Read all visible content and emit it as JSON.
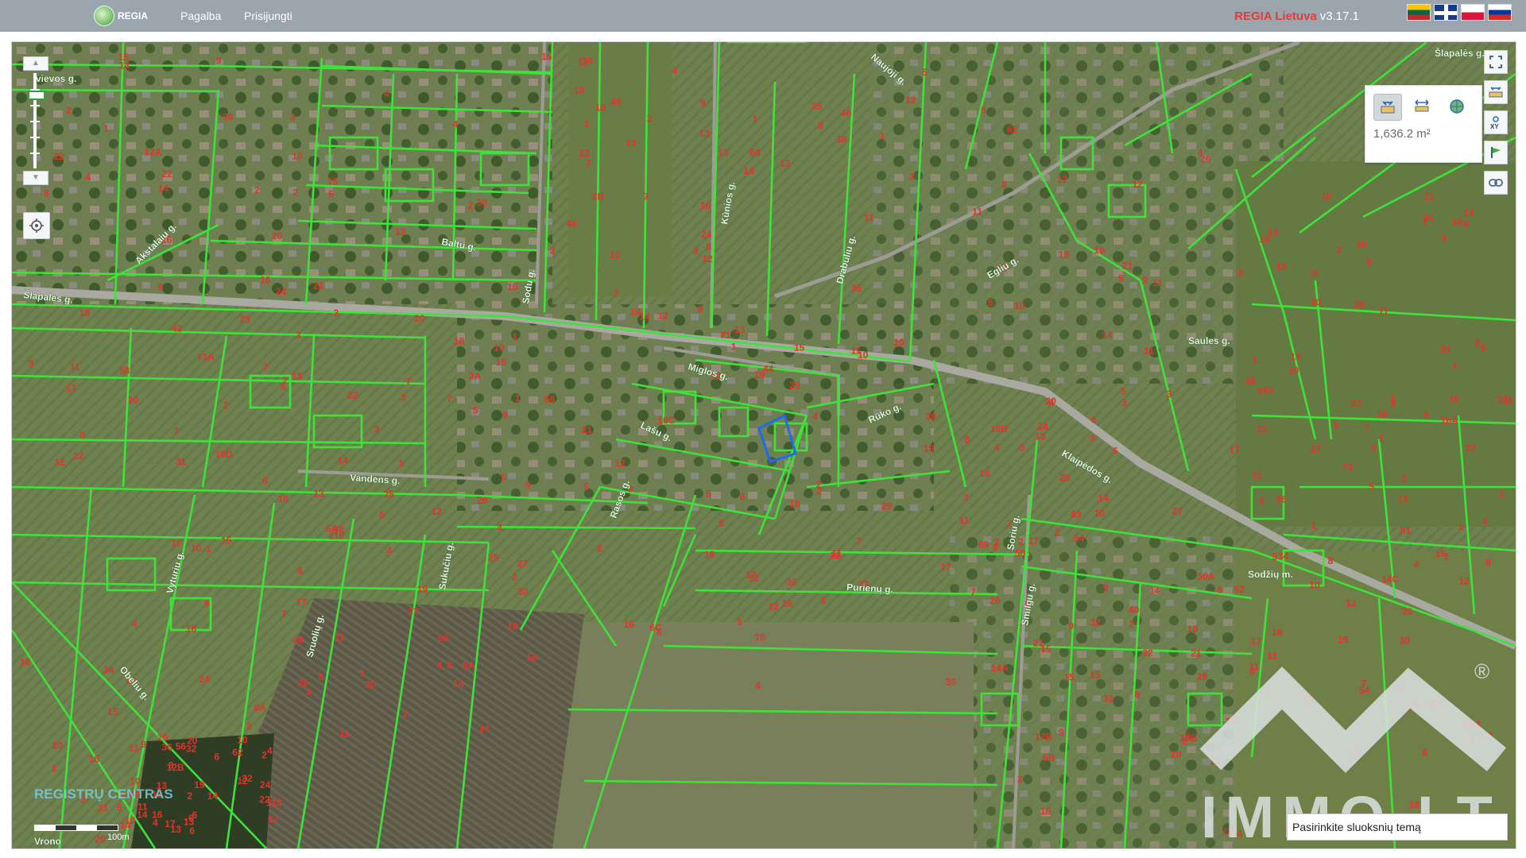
{
  "header": {
    "logo_text": "REGIA",
    "nav": [
      "Pagalba",
      "Prisijungti"
    ],
    "brand": "REGIA Lietuva",
    "version": "v3.17.1",
    "languages": [
      "lt",
      "en",
      "pl",
      "ru"
    ]
  },
  "measure": {
    "area_value": "1,636.2 m²"
  },
  "layer_selector": {
    "label": "Pasirinkite sluoksnių temą"
  },
  "watermark": {
    "text": "IMMO.LT",
    "registered": "®",
    "provider": "REGISTRŲ CENTRAS"
  },
  "scale": {
    "label": "100m"
  },
  "streets": [
    {
      "id": "slapaliu-w",
      "text": "Šlapalės g."
    },
    {
      "id": "slapaliu-ne",
      "text": "Šlapalės g."
    },
    {
      "id": "vievios",
      "text": "vievos g."
    },
    {
      "id": "akstalaiu",
      "text": "Akstalaiu g."
    },
    {
      "id": "baltu",
      "text": "Baltu g."
    },
    {
      "id": "sodu",
      "text": "Sodu g."
    },
    {
      "id": "kaunos",
      "text": "Kūnios g."
    },
    {
      "id": "drabuliu",
      "text": "Drabuliu g."
    },
    {
      "id": "egliu",
      "text": "Egliu g."
    },
    {
      "id": "naujoji",
      "text": "Naujoji g."
    },
    {
      "id": "saules",
      "text": "Saules g."
    },
    {
      "id": "miglos",
      "text": "Miglos g."
    },
    {
      "id": "ruko",
      "text": "Rūko g."
    },
    {
      "id": "lasu",
      "text": "Lašu g."
    },
    {
      "id": "rasos",
      "text": "Rasos g."
    },
    {
      "id": "klaipedos",
      "text": "Klaipėdos g."
    },
    {
      "id": "vandens",
      "text": "Vandens g."
    },
    {
      "id": "vyturiu",
      "text": "Vyturiu g."
    },
    {
      "id": "sukuciu",
      "text": "Sukučiu g."
    },
    {
      "id": "sruoliu",
      "text": "Sruolių g."
    },
    {
      "id": "obeliu",
      "text": "Obeliu g."
    },
    {
      "id": "purienu",
      "text": "Purienų g."
    },
    {
      "id": "smilgu",
      "text": "Smilgu g."
    },
    {
      "id": "soriu",
      "text": "Soriu g."
    },
    {
      "id": "sodzius",
      "text": "Sodžių m."
    },
    {
      "id": "vrono",
      "text": "Vrono"
    }
  ],
  "parcels": [
    {
      "t": "2"
    },
    {
      "t": "1"
    },
    {
      "t": "11"
    },
    {
      "t": "9"
    },
    {
      "t": "7"
    },
    {
      "t": "5"
    },
    {
      "t": "3"
    },
    {
      "t": "1"
    },
    {
      "t": "10"
    },
    {
      "t": "17"
    },
    {
      "t": "8"
    },
    {
      "t": "15"
    },
    {
      "t": "6"
    },
    {
      "t": "4"
    },
    {
      "t": "2"
    },
    {
      "t": "13"
    },
    {
      "t": "11"
    },
    {
      "t": "10"
    },
    {
      "t": "7"
    },
    {
      "t": "9"
    },
    {
      "t": "6"
    },
    {
      "t": "5"
    },
    {
      "t": "3"
    },
    {
      "t": "4"
    },
    {
      "t": "1"
    },
    {
      "t": "2"
    },
    {
      "t": "18"
    },
    {
      "t": "20"
    },
    {
      "t": "22"
    },
    {
      "t": "24"
    },
    {
      "t": "26"
    },
    {
      "t": "28"
    },
    {
      "t": "16D"
    },
    {
      "t": "16C"
    },
    {
      "t": "16B"
    },
    {
      "t": "16A"
    },
    {
      "t": "16"
    },
    {
      "t": "14"
    },
    {
      "t": "14A"
    },
    {
      "t": "14B"
    },
    {
      "t": "14C"
    },
    {
      "t": "12B"
    },
    {
      "t": "12A"
    },
    {
      "t": "12"
    },
    {
      "t": "10"
    },
    {
      "t": "8"
    },
    {
      "t": "6"
    },
    {
      "t": "4"
    },
    {
      "t": "2"
    },
    {
      "t": "3"
    },
    {
      "t": "1"
    },
    {
      "t": "25"
    },
    {
      "t": "27"
    },
    {
      "t": "20"
    },
    {
      "t": "18"
    },
    {
      "t": "16"
    },
    {
      "t": "14"
    },
    {
      "t": "12"
    },
    {
      "t": "10"
    },
    {
      "t": "8"
    },
    {
      "t": "23"
    },
    {
      "t": "21"
    },
    {
      "t": "19"
    },
    {
      "t": "17"
    },
    {
      "t": "15"
    },
    {
      "t": "13"
    },
    {
      "t": "11"
    },
    {
      "t": "9"
    },
    {
      "t": "7"
    },
    {
      "t": "5"
    },
    {
      "t": "20"
    },
    {
      "t": "18"
    },
    {
      "t": "16"
    },
    {
      "t": "14"
    },
    {
      "t": "12"
    },
    {
      "t": "10"
    },
    {
      "t": "8"
    },
    {
      "t": "6"
    },
    {
      "t": "4"
    },
    {
      "t": "2"
    },
    {
      "t": "16"
    },
    {
      "t": "18"
    },
    {
      "t": "20"
    },
    {
      "t": "22"
    },
    {
      "t": "24"
    },
    {
      "t": "14"
    },
    {
      "t": "12"
    },
    {
      "t": "10"
    },
    {
      "t": "8"
    },
    {
      "t": "6"
    },
    {
      "t": "4"
    },
    {
      "t": "2"
    },
    {
      "t": "16"
    },
    {
      "t": "14"
    },
    {
      "t": "12"
    },
    {
      "t": "10"
    },
    {
      "t": "8"
    },
    {
      "t": "6"
    },
    {
      "t": "4"
    },
    {
      "t": "9"
    },
    {
      "t": "11"
    },
    {
      "t": "10"
    },
    {
      "t": "7"
    },
    {
      "t": "5"
    },
    {
      "t": "3"
    },
    {
      "t": "1"
    },
    {
      "t": "21"
    },
    {
      "t": "19"
    },
    {
      "t": "17"
    },
    {
      "t": "15"
    },
    {
      "t": "13"
    },
    {
      "t": "11"
    },
    {
      "t": "3"
    },
    {
      "t": "7"
    },
    {
      "t": "5"
    },
    {
      "t": "1"
    },
    {
      "t": "2"
    },
    {
      "t": "10"
    },
    {
      "t": "24"
    },
    {
      "t": "22"
    },
    {
      "t": "20"
    },
    {
      "t": "26"
    },
    {
      "t": "30"
    },
    {
      "t": "32"
    },
    {
      "t": "34"
    },
    {
      "t": "18"
    },
    {
      "t": "16"
    },
    {
      "t": "14"
    },
    {
      "t": "12"
    },
    {
      "t": "10"
    },
    {
      "t": "8"
    },
    {
      "t": "6"
    },
    {
      "t": "4"
    },
    {
      "t": "2"
    },
    {
      "t": "8A"
    },
    {
      "t": "6A"
    },
    {
      "t": "6C"
    },
    {
      "t": "6B"
    },
    {
      "t": "1"
    },
    {
      "t": "3"
    },
    {
      "t": "5"
    },
    {
      "t": "7"
    },
    {
      "t": "9"
    },
    {
      "t": "11"
    },
    {
      "t": "13"
    },
    {
      "t": "15"
    },
    {
      "t": "17"
    },
    {
      "t": "1"
    },
    {
      "t": "3"
    },
    {
      "t": "5"
    },
    {
      "t": "7"
    },
    {
      "t": "9"
    },
    {
      "t": "11"
    },
    {
      "t": "13"
    },
    {
      "t": "2"
    },
    {
      "t": "4"
    },
    {
      "t": "6"
    },
    {
      "t": "8"
    },
    {
      "t": "10"
    },
    {
      "t": "12"
    },
    {
      "t": "14"
    },
    {
      "t": "16"
    },
    {
      "t": "18"
    },
    {
      "t": "25"
    },
    {
      "t": "23"
    },
    {
      "t": "21"
    },
    {
      "t": "19"
    },
    {
      "t": "17"
    },
    {
      "t": "15"
    },
    {
      "t": "13"
    },
    {
      "t": "11"
    },
    {
      "t": "5"
    },
    {
      "t": "3"
    },
    {
      "t": "1"
    },
    {
      "t": "6"
    },
    {
      "t": "8"
    },
    {
      "t": "10"
    },
    {
      "t": "4"
    },
    {
      "t": "2"
    },
    {
      "t": "15"
    },
    {
      "t": "17"
    },
    {
      "t": "19"
    },
    {
      "t": "21"
    },
    {
      "t": "23"
    },
    {
      "t": "25"
    },
    {
      "t": "13"
    },
    {
      "t": "11"
    },
    {
      "t": "9"
    },
    {
      "t": "7"
    },
    {
      "t": "5"
    },
    {
      "t": "3"
    },
    {
      "t": "1"
    },
    {
      "t": "12"
    },
    {
      "t": "10"
    },
    {
      "t": "8"
    },
    {
      "t": "6"
    },
    {
      "t": "4"
    },
    {
      "t": "2"
    },
    {
      "t": "21"
    },
    {
      "t": "19"
    },
    {
      "t": "17"
    },
    {
      "t": "15"
    },
    {
      "t": "13"
    },
    {
      "t": "11"
    },
    {
      "t": "9"
    },
    {
      "t": "7"
    },
    {
      "t": "5"
    },
    {
      "t": "3"
    },
    {
      "t": "1"
    },
    {
      "t": "10"
    },
    {
      "t": "2"
    },
    {
      "t": "1"
    },
    {
      "t": "3"
    },
    {
      "t": "5"
    },
    {
      "t": "7"
    },
    {
      "t": "9"
    },
    {
      "t": "11"
    },
    {
      "t": "13"
    },
    {
      "t": "15"
    },
    {
      "t": "17"
    },
    {
      "t": "19"
    },
    {
      "t": "2"
    },
    {
      "t": "4"
    },
    {
      "t": "6"
    },
    {
      "t": "8"
    },
    {
      "t": "10"
    },
    {
      "t": "12"
    },
    {
      "t": "14"
    },
    {
      "t": "16"
    },
    {
      "t": "18"
    },
    {
      "t": "5"
    },
    {
      "t": "22"
    },
    {
      "t": "20"
    },
    {
      "t": "18"
    },
    {
      "t": "16"
    },
    {
      "t": "14"
    },
    {
      "t": "12"
    },
    {
      "t": "10"
    },
    {
      "t": "8"
    },
    {
      "t": "6"
    },
    {
      "t": "4"
    },
    {
      "t": "2"
    },
    {
      "t": "3"
    },
    {
      "t": "1"
    },
    {
      "t": "83"
    },
    {
      "t": "81"
    },
    {
      "t": "113"
    },
    {
      "t": "110"
    },
    {
      "t": "23"
    },
    {
      "t": "21"
    },
    {
      "t": "19"
    },
    {
      "t": "17"
    },
    {
      "t": "15"
    },
    {
      "t": "13"
    },
    {
      "t": "11"
    },
    {
      "t": "9"
    },
    {
      "t": "7"
    },
    {
      "t": "5"
    },
    {
      "t": "3"
    },
    {
      "t": "1"
    },
    {
      "t": "62"
    },
    {
      "t": "60"
    },
    {
      "t": "58"
    },
    {
      "t": "52"
    },
    {
      "t": "54"
    },
    {
      "t": "56"
    },
    {
      "t": "50"
    },
    {
      "t": "48"
    },
    {
      "t": "46"
    },
    {
      "t": "40"
    },
    {
      "t": "42"
    },
    {
      "t": "44"
    },
    {
      "t": "38"
    },
    {
      "t": "36"
    },
    {
      "t": "34"
    },
    {
      "t": "28"
    },
    {
      "t": "30"
    },
    {
      "t": "32"
    },
    {
      "t": "26"
    },
    {
      "t": "24"
    },
    {
      "t": "22"
    },
    {
      "t": "16"
    },
    {
      "t": "18"
    },
    {
      "t": "20"
    },
    {
      "t": "14"
    },
    {
      "t": "12"
    },
    {
      "t": "10"
    },
    {
      "t": "4"
    },
    {
      "t": "6"
    },
    {
      "t": "8"
    },
    {
      "t": "2"
    },
    {
      "t": "17B"
    },
    {
      "t": "17A"
    },
    {
      "t": "19"
    },
    {
      "t": "4"
    },
    {
      "t": "6"
    },
    {
      "t": "8"
    },
    {
      "t": "10"
    },
    {
      "t": "12"
    },
    {
      "t": "2"
    },
    {
      "t": "20"
    },
    {
      "t": "5"
    },
    {
      "t": "1"
    },
    {
      "t": "3"
    },
    {
      "t": "7"
    },
    {
      "t": "9"
    },
    {
      "t": "11"
    },
    {
      "t": "13"
    },
    {
      "t": "15"
    },
    {
      "t": "10"
    },
    {
      "t": "12"
    },
    {
      "t": "14"
    },
    {
      "t": "71A"
    },
    {
      "t": "71"
    },
    {
      "t": "69"
    },
    {
      "t": "73"
    },
    {
      "t": "2"
    },
    {
      "t": "5A"
    },
    {
      "t": "50"
    },
    {
      "t": "50A"
    },
    {
      "t": "12"
    },
    {
      "t": "14"
    },
    {
      "t": "16"
    },
    {
      "t": "10"
    },
    {
      "t": "6"
    },
    {
      "t": "1"
    },
    {
      "t": "3"
    },
    {
      "t": "5"
    },
    {
      "t": "2"
    },
    {
      "t": "4"
    },
    {
      "t": "6"
    },
    {
      "t": "8"
    },
    {
      "t": "30"
    },
    {
      "t": "32"
    },
    {
      "t": "34"
    },
    {
      "t": "36"
    },
    {
      "t": "1"
    },
    {
      "t": "3"
    },
    {
      "t": "5"
    },
    {
      "t": "7"
    },
    {
      "t": "2"
    },
    {
      "t": "4"
    },
    {
      "t": "6"
    },
    {
      "t": "22"
    },
    {
      "t": "24"
    },
    {
      "t": "20"
    },
    {
      "t": "26"
    },
    {
      "t": "28"
    },
    {
      "t": "30"
    },
    {
      "t": "32"
    },
    {
      "t": "10"
    },
    {
      "t": "12"
    },
    {
      "t": "14"
    },
    {
      "t": "16"
    },
    {
      "t": "18"
    },
    {
      "t": "1"
    },
    {
      "t": "3"
    },
    {
      "t": "5"
    },
    {
      "t": "2"
    },
    {
      "t": "4"
    },
    {
      "t": "6"
    },
    {
      "t": "8"
    },
    {
      "t": "10"
    },
    {
      "t": "12"
    },
    {
      "t": "14"
    },
    {
      "t": "16"
    },
    {
      "t": "1"
    },
    {
      "t": "2"
    },
    {
      "t": "3"
    },
    {
      "t": "3A"
    },
    {
      "t": "5"
    },
    {
      "t": "7"
    },
    {
      "t": "9"
    },
    {
      "t": "11"
    },
    {
      "t": "4"
    },
    {
      "t": "6"
    },
    {
      "t": "8"
    },
    {
      "t": "10"
    },
    {
      "t": "12"
    },
    {
      "t": "64"
    },
    {
      "t": "62"
    },
    {
      "t": "60"
    },
    {
      "t": "58"
    },
    {
      "t": "56"
    },
    {
      "t": "54"
    },
    {
      "t": "52"
    },
    {
      "t": "66"
    },
    {
      "t": "68"
    },
    {
      "t": "70"
    },
    {
      "t": "40"
    },
    {
      "t": "38"
    },
    {
      "t": "42"
    },
    {
      "t": "30"
    },
    {
      "t": "48"
    },
    {
      "t": "38"
    },
    {
      "t": "24"
    },
    {
      "t": "22"
    },
    {
      "t": "29"
    },
    {
      "t": "20"
    },
    {
      "t": "34"
    },
    {
      "t": "32"
    },
    {
      "t": "30"
    },
    {
      "t": "17"
    },
    {
      "t": "15"
    },
    {
      "t": "13"
    },
    {
      "t": "11"
    },
    {
      "t": "9"
    },
    {
      "t": "7"
    },
    {
      "t": "5"
    },
    {
      "t": "3"
    },
    {
      "t": "1"
    },
    {
      "t": "2"
    },
    {
      "t": "18"
    },
    {
      "t": "16"
    },
    {
      "t": "14"
    },
    {
      "t": "12"
    },
    {
      "t": "10"
    },
    {
      "t": "8"
    },
    {
      "t": "6"
    },
    {
      "t": "4"
    },
    {
      "t": "2"
    },
    {
      "t": "2B"
    },
    {
      "t": "13"
    },
    {
      "t": "11"
    },
    {
      "t": "20"
    },
    {
      "t": "19"
    },
    {
      "t": "17"
    },
    {
      "t": "15"
    },
    {
      "t": "13"
    },
    {
      "t": "11"
    },
    {
      "t": "9"
    },
    {
      "t": "10"
    },
    {
      "t": "12"
    },
    {
      "t": "14"
    },
    {
      "t": "16"
    },
    {
      "t": "18"
    },
    {
      "t": "35"
    },
    {
      "t": "33"
    },
    {
      "t": "31"
    },
    {
      "t": "29"
    },
    {
      "t": "27"
    },
    {
      "t": "8"
    }
  ]
}
